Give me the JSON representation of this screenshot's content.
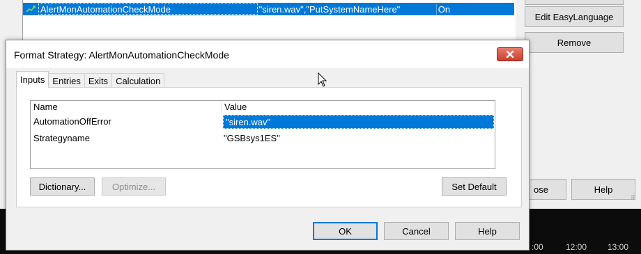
{
  "background": {
    "list_row": {
      "name": "AlertMonAutomationCheckMode",
      "params": "\"siren.wav\",\"PutSystemNameHere\"",
      "status": "On"
    },
    "buttons": {
      "edit_easylanguage": "Edit EasyLanguage",
      "remove": "Remove",
      "close_partial": "ose",
      "help": "Help"
    },
    "time_labels": [
      ":00",
      "12:00",
      "13:00"
    ]
  },
  "dialog": {
    "title": "Format Strategy: AlertMonAutomationCheckMode",
    "tabs": [
      "Inputs",
      "Entries",
      "Exits",
      "Calculation"
    ],
    "active_tab": "Inputs",
    "grid": {
      "headers": {
        "name": "Name",
        "value": "Value"
      },
      "rows": [
        {
          "name": "AutomationOffError",
          "value": "\"siren.wav\"",
          "selected": true
        },
        {
          "name": "Strategyname",
          "value": "\"GSBsys1ES\"",
          "selected": false
        }
      ]
    },
    "buttons": {
      "dictionary": "Dictionary...",
      "optimize": "Optimize...",
      "set_default": "Set Default",
      "ok": "OK",
      "cancel": "Cancel",
      "help": "Help"
    }
  },
  "colors": {
    "selection": "#0078d7",
    "close_button": "#c8402e"
  }
}
